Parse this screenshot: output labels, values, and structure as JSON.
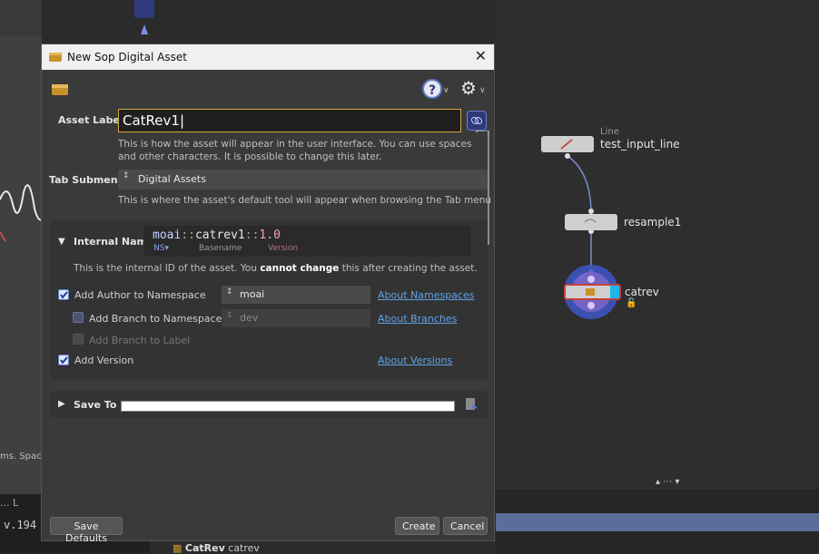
{
  "background": {
    "help_text_fragment": "ms. Space",
    "version_fragment": "v.194",
    "bottom_dots": "... L",
    "tab_bold": "CatRev",
    "tab_rest": "catrev",
    "node_line_sub": "Line",
    "node_line_label": "test_input_line",
    "node_resample_label": "resample1",
    "node_catrev_label": "catrev",
    "panel_controls": "▴ ⋯ ▾"
  },
  "dialog": {
    "title": "New Sop Digital Asset",
    "asset_label": {
      "label": "Asset Label",
      "value": "CatRev1",
      "help": "This is how the asset will appear in the user interface. You can use spaces and other characters. It is possible to change this later."
    },
    "tab_submenu": {
      "label": "Tab Submenu",
      "value": "Digital Assets",
      "help": "This is where the asset's default tool will appear when browsing the Tab menu"
    },
    "internal_name": {
      "label": "Internal Name",
      "value_ns": "moai",
      "value_sep1": "::",
      "value_base": "catrev1",
      "value_sep2": "::",
      "value_ver": "1.0",
      "sub_ns": "NS▾",
      "sub_base": "Basename",
      "sub_ver": "Version",
      "help_a": "This is the internal ID of the asset. You ",
      "help_b": "cannot change",
      "help_c": " this after creating the asset."
    },
    "options": {
      "author_label": "Add Author to Namespace",
      "author_value": "moai",
      "author_link": "About Namespaces",
      "branch_label": "Add Branch to Namespace",
      "branch_value": "dev",
      "branch_link": "About Branches",
      "branch_to_label": "Add Branch to Label",
      "version_label": "Add Version",
      "version_link": "About Versions"
    },
    "save_to": {
      "label": "Save To"
    },
    "buttons": {
      "save_defaults": "Save Defaults",
      "create": "Create",
      "cancel": "Cancel"
    },
    "colors": {
      "accent": "#d8a640",
      "link": "#5fa3e6",
      "check": "#5b79c8"
    }
  }
}
